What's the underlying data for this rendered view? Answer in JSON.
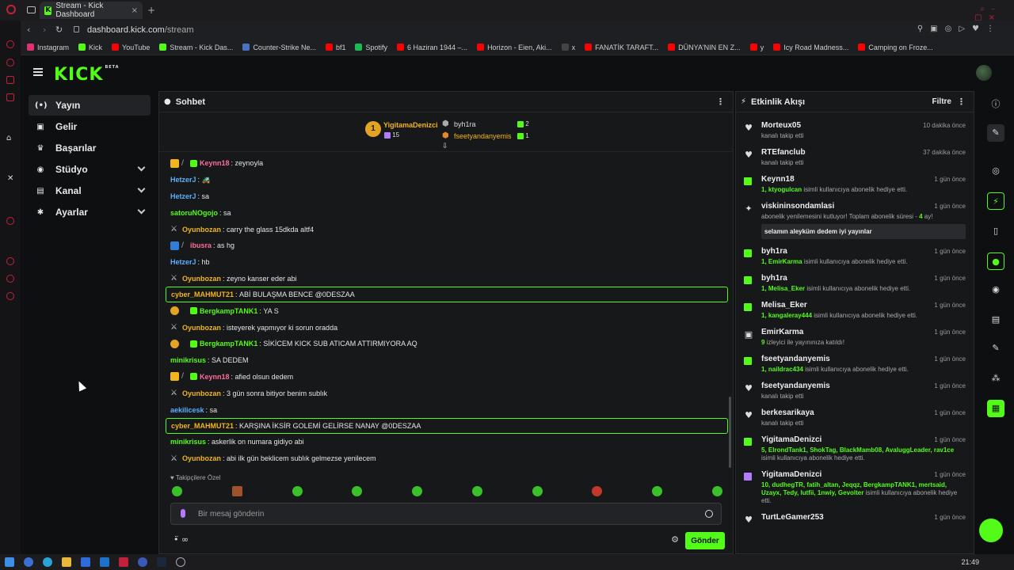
{
  "browser": {
    "tab_title": "Stream - Kick Dashboard",
    "url_host": "dashboard.kick.com",
    "url_path": "/stream",
    "bookmarks": [
      {
        "label": "Instagram",
        "color": "#e1306c"
      },
      {
        "label": "Kick",
        "color": "#53fc18"
      },
      {
        "label": "YouTube",
        "color": "#ff0000"
      },
      {
        "label": "Stream - Kick Das...",
        "color": "#53fc18"
      },
      {
        "label": "Counter-Strike Ne...",
        "color": "#4b72c2"
      },
      {
        "label": "bf1",
        "color": "#ff0000"
      },
      {
        "label": "Spotify",
        "color": "#1db954"
      },
      {
        "label": "6 Haziran 1944 –...",
        "color": "#ff0000"
      },
      {
        "label": "Horizon - Eien, Aki...",
        "color": "#ff0000"
      },
      {
        "label": "x",
        "color": "#444444"
      },
      {
        "label": "FANATİK TARAFT...",
        "color": "#ff0000"
      },
      {
        "label": "DÜNYA'NIN EN Z...",
        "color": "#ff0000"
      },
      {
        "label": "y",
        "color": "#ff0000"
      },
      {
        "label": "Icy Road Madness...",
        "color": "#ff0000"
      },
      {
        "label": "Camping on Froze...",
        "color": "#ff0000"
      }
    ]
  },
  "app": {
    "logo": "KICK",
    "logo_tag": "BETA",
    "accent": "#53fc18"
  },
  "sidebar": {
    "items": [
      {
        "label": "Yayın",
        "icon": "broadcast-icon",
        "glyph": "(•)",
        "active": true,
        "expandable": false
      },
      {
        "label": "Gelir",
        "icon": "income-icon",
        "glyph": "▣",
        "active": false,
        "expandable": false
      },
      {
        "label": "Başarılar",
        "icon": "trophy-icon",
        "glyph": "♛",
        "active": false,
        "expandable": false
      },
      {
        "label": "Stüdyo",
        "icon": "studio-icon",
        "glyph": "◉",
        "active": false,
        "expandable": true
      },
      {
        "label": "Kanal",
        "icon": "channel-icon",
        "glyph": "▤",
        "active": false,
        "expandable": true
      },
      {
        "label": "Ayarlar",
        "icon": "settings-icon",
        "glyph": "✱",
        "active": false,
        "expandable": true
      }
    ]
  },
  "chat": {
    "title": "Sohbet",
    "top_gifters": [
      {
        "name": "YigitamaDenizci",
        "rank": "1",
        "count": "15"
      },
      {
        "name": "byh1ra",
        "count": "2"
      },
      {
        "name": "fseetyandanyemis",
        "count": "1"
      }
    ],
    "messages": [
      {
        "badges": [
          "crown",
          "pen",
          "gift"
        ],
        "user": "Keynn18",
        "color": "#ff6b9a",
        "text": "zeynoyla",
        "highlight": false
      },
      {
        "badges": [],
        "user": "HetzerJ",
        "color": "#5ab0ff",
        "text": "🚜",
        "highlight": false
      },
      {
        "badges": [],
        "user": "HetzerJ",
        "color": "#5ab0ff",
        "text": "sa",
        "highlight": false
      },
      {
        "badges": [],
        "user": "satoruNOgojo",
        "color": "#53fc18",
        "text": "sa",
        "highlight": false
      },
      {
        "badges": [
          "sword"
        ],
        "user": "Oyunbozan",
        "color": "#f2b51b",
        "text": "carry the glass 15dkda altf4",
        "highlight": false
      },
      {
        "badges": [
          "blue",
          "pen"
        ],
        "user": "ibusra",
        "color": "#ff6b9a",
        "text": "as hg",
        "highlight": false
      },
      {
        "badges": [],
        "user": "HetzerJ",
        "color": "#5ab0ff",
        "text": "hb",
        "highlight": false
      },
      {
        "badges": [
          "sword"
        ],
        "user": "Oyunbozan",
        "color": "#f2b51b",
        "text": "zeyno kanser eder abi",
        "highlight": false
      },
      {
        "badges": [],
        "user": "cyber_MAHMUT21",
        "color": "#f2b51b",
        "text": "ABİ BULAŞMA BENCE @0DESZAA",
        "highlight": true
      },
      {
        "badges": [
          "coin",
          "gift"
        ],
        "user": "BergkampTANK1",
        "color": "#53fc18",
        "text": "YA S",
        "highlight": false
      },
      {
        "badges": [
          "sword"
        ],
        "user": "Oyunbozan",
        "color": "#f2b51b",
        "text": "isteyerek yapmıyor ki sorun oradda",
        "highlight": false
      },
      {
        "badges": [
          "coin",
          "gift"
        ],
        "user": "BergkampTANK1",
        "color": "#53fc18",
        "text": "SİKİCEM KICK SUB ATICAM ATTIRMIYORA AQ",
        "highlight": false
      },
      {
        "badges": [],
        "user": "minikrisus",
        "color": "#53fc18",
        "text": "SA DEDEM",
        "highlight": false
      },
      {
        "badges": [
          "crown",
          "pen",
          "gift"
        ],
        "user": "Keynn18",
        "color": "#ff6b9a",
        "text": "afied olsun dedem",
        "highlight": false
      },
      {
        "badges": [
          "sword"
        ],
        "user": "Oyunbozan",
        "color": "#f2b51b",
        "text": "3 gün sonra bitiyor benim sublık",
        "highlight": false
      },
      {
        "badges": [],
        "user": "aekilicesk",
        "color": "#5ab0ff",
        "text": "sa",
        "highlight": false
      },
      {
        "badges": [],
        "user": "cyber_MAHMUT21",
        "color": "#f2b51b",
        "text": "KARŞINA İKSİR GOLEMİ GELİRSE NANAY @0DESZAA",
        "highlight": true
      },
      {
        "badges": [],
        "user": "minikrisus",
        "color": "#53fc18",
        "text": "askerlik on numara gidiyo abi",
        "highlight": false
      },
      {
        "badges": [
          "sword"
        ],
        "user": "Oyunbozan",
        "color": "#f2b51b",
        "text": "abi ilk gün beklicem sublık gelmezse yenilecem",
        "highlight": false
      }
    ],
    "followers_only": "♥ Takipçilere Özel",
    "input_placeholder": "Bir mesaj gönderin",
    "send_label": "Gönder",
    "footer_left": "•̈ ∞"
  },
  "activity": {
    "title": "Etkinlik Akışı",
    "filter_label": "Filtre",
    "events": [
      {
        "icon": "heart",
        "name": "Morteux05",
        "time": "10 dakika önce",
        "sub": "kanalı takip etti"
      },
      {
        "icon": "heart",
        "name": "RTEfanclub",
        "time": "37 dakika önce",
        "sub": "kanalı takip etti"
      },
      {
        "icon": "gift",
        "name": "Keynn18",
        "time": "1 gün önce",
        "green": "1, ktyogulcan",
        "sub": "isimli kullanıcıya abonelik hediye etti."
      },
      {
        "icon": "party",
        "name": "viskininsondamlasi",
        "time": "1 gün önce",
        "sub": "abonelik yenilemesini kutluyor! Toplam abonelik süresi - ",
        "months": "4",
        "months_suffix": "ay!",
        "quote": "selamın aleyküm dedem iyi yayınlar"
      },
      {
        "icon": "gift",
        "name": "byh1ra",
        "time": "1 gün önce",
        "green": "1, EmirKarma",
        "sub": "isimli kullanıcıya abonelik hediye etti."
      },
      {
        "icon": "gift",
        "name": "byh1ra",
        "time": "1 gün önce",
        "green": "1, Melisa_Eker",
        "sub": "isimli kullanıcıya abonelik hediye etti."
      },
      {
        "icon": "gift",
        "name": "Melisa_Eker",
        "time": "1 gün önce",
        "green": "1, kangaleray444",
        "sub": "isimli kullanıcıya abonelik hediye etti."
      },
      {
        "icon": "host",
        "name": "EmirKarma",
        "time": "1 gün önce",
        "green": "9",
        "sub": "izleyici ile yayınınıza katıldı!"
      },
      {
        "icon": "gift",
        "name": "fseetyandanyemis",
        "time": "1 gün önce",
        "green": "1, naildrac434",
        "sub": "isimli kullanıcıya abonelik hediye etti."
      },
      {
        "icon": "heart",
        "name": "fseetyandanyemis",
        "time": "1 gün önce",
        "sub": "kanalı takip etti"
      },
      {
        "icon": "heart",
        "name": "berkesarikaya",
        "time": "1 gün önce",
        "sub": "kanalı takip etti"
      },
      {
        "icon": "gift",
        "name": "YigitamaDenizci",
        "time": "1 gün önce",
        "green": "5, ElrondTank1, ShokTag, BlackMamb08, AvaluggLeader, rav1ce",
        "sub": "isimli kullanıcıya abonelik hediye etti."
      },
      {
        "icon": "pgift",
        "name": "YigitamaDenizci",
        "time": "1 gün önce",
        "green": "10, dudhegTR, fatih_altan, Jeqqz, BergkampTANK1, mertsaid, Uzayx, Tedy, lutfii, 1nwiy, Gevolter",
        "sub": "isimli kullanıcıya abonelik hediye etti."
      },
      {
        "icon": "heart",
        "name": "TurtLeGamer253",
        "time": "1 gün önce",
        "sub": ""
      }
    ]
  },
  "taskbar": {
    "time": "21:49"
  }
}
